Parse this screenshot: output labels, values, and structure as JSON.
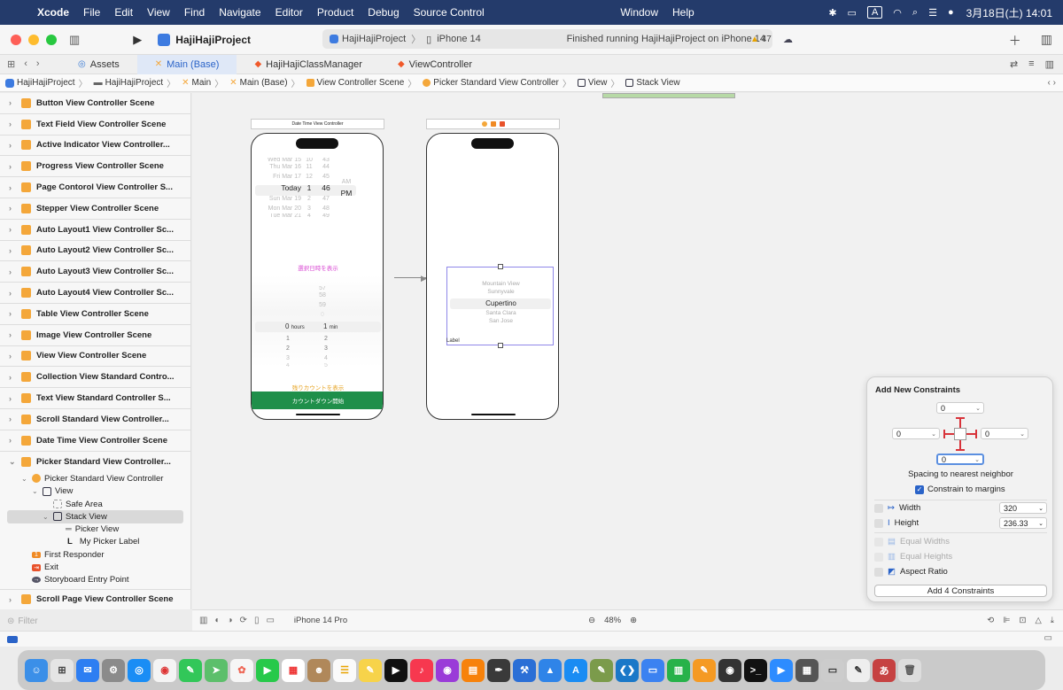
{
  "menubar": {
    "app": "Xcode",
    "items": [
      "File",
      "Edit",
      "View",
      "Find",
      "Navigate",
      "Editor",
      "Product",
      "Debug",
      "Source Control"
    ],
    "right_items": [
      "Window",
      "Help"
    ],
    "input_source": "A",
    "datetime": "3月18日(土) 14:01"
  },
  "toolbar": {
    "project_name": "HajiHajiProject",
    "scheme": "HajiHajiProject",
    "device": "iPhone 14",
    "status": "Finished running HajiHajiProject on iPhone 14",
    "warnings": "47"
  },
  "tabs": [
    {
      "label": "Assets",
      "icon": "assets-icon"
    },
    {
      "label": "Main (Base)",
      "icon": "storyboard-icon"
    },
    {
      "label": "HajiHajiClassManager",
      "icon": "swift-icon"
    },
    {
      "label": "ViewController",
      "icon": "swift-icon"
    }
  ],
  "breadcrumbs": [
    "HajiHajiProject",
    "HajiHajiProject",
    "Main",
    "Main (Base)",
    "View Controller Scene",
    "Picker Standard View Controller",
    "View",
    "Stack View"
  ],
  "navigator": {
    "scenes_top": [
      "Button View Controller Scene",
      "Text Field View Controller Scene",
      "Active Indicator View Controller...",
      "Progress View Controller Scene",
      "Page Contorol View Controller S...",
      "Stepper View Controller Scene",
      "Auto Layout1 View Controller Sc...",
      "Auto Layout2 View Controller Sc...",
      "Auto Layout3 View Controller Sc...",
      "Auto Layout4 View Controller Sc...",
      "Table View Controller Scene",
      "Image View Controller Scene",
      "View View Controller Scene",
      "Collection View Standard Contro...",
      "Text View Standard Controller S...",
      "Scroll Standard View Controller...",
      "Date Time View Controller Scene",
      "Picker Standard View Controller..."
    ],
    "tree": {
      "controller": "Picker Standard View Controller",
      "view": "View",
      "safe_area": "Safe Area",
      "stack_view": "Stack View",
      "picker_view": "Picker View",
      "picker_label": "My Picker Label",
      "first_responder": "First Responder",
      "exit": "Exit",
      "entry": "Storyboard Entry Point"
    },
    "scene_bottom": "Scroll Page View Controller Scene",
    "filter_placeholder": "Filter"
  },
  "canvas": {
    "scene1_title": "Date Time View Controller",
    "date_rows": [
      "Wed Mar 15",
      "Thu Mar 16",
      "Fri Mar 17",
      "Today",
      "Sun Mar 19",
      "Mon Mar 20",
      "Tue Mar 21"
    ],
    "hour_rows": [
      "10",
      "11",
      "12",
      "1",
      "2",
      "3",
      "4"
    ],
    "min_rows": [
      "43",
      "44",
      "45",
      "46",
      "47",
      "48",
      "49"
    ],
    "ampm": [
      "AM",
      "PM"
    ],
    "show_label": "選択日時を表示",
    "timer_above": [
      "57",
      "58",
      "59",
      "0"
    ],
    "timer_hours": "0",
    "timer_hours_label": "hours",
    "timer_min": "1",
    "timer_min_label": "min",
    "timer_below_left": [
      "1",
      "2",
      "3",
      "4"
    ],
    "timer_below_right": [
      "2",
      "3",
      "4",
      "5"
    ],
    "remaining_label": "残りカウントを表示",
    "countdown_button": "カウントダウン開始",
    "cities": [
      "Mountain View",
      "Sunnyvale",
      "Cupertino",
      "Santa Clara",
      "San Jose"
    ],
    "stack_label": "Label"
  },
  "constraints": {
    "title": "Add New Constraints",
    "top": "0",
    "left": "0",
    "right": "0",
    "bottom": "0",
    "spacing_label": "Spacing to nearest neighbor",
    "constrain_margins": "Constrain to margins",
    "width_label": "Width",
    "width_value": "320",
    "height_label": "Height",
    "height_value": "236.33",
    "equal_widths": "Equal Widths",
    "equal_heights": "Equal Heights",
    "aspect_ratio": "Aspect Ratio",
    "add_button": "Add 4 Constraints"
  },
  "bottombar": {
    "device": "iPhone 14 Pro",
    "zoom": "48%"
  },
  "colors": {
    "menubar": "#243b6b",
    "accent": "#2a63c8",
    "green_button": "#1f8f4a",
    "pink_text": "#d94ad3",
    "orange_text": "#e6a322",
    "constraint_red": "#d8333a"
  }
}
